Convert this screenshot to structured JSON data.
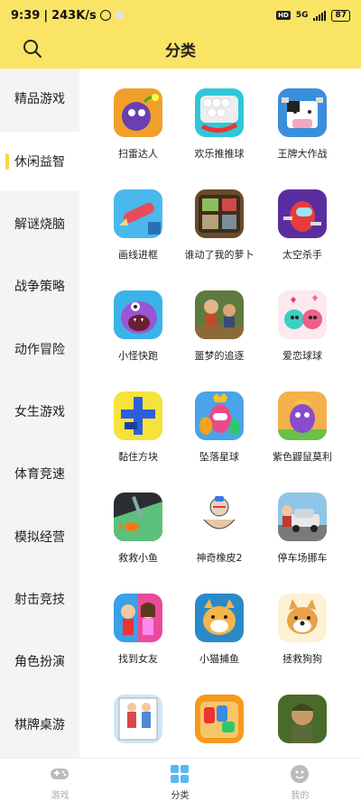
{
  "status": {
    "time": "9:39",
    "net_speed": "243K/s",
    "network": "5G",
    "battery": "87"
  },
  "header": {
    "title": "分类"
  },
  "sidebar": {
    "items": [
      {
        "label": "精品游戏"
      },
      {
        "label": "休闲益智"
      },
      {
        "label": "解谜烧脑"
      },
      {
        "label": "战争策略"
      },
      {
        "label": "动作冒险"
      },
      {
        "label": "女生游戏"
      },
      {
        "label": "体育竞速"
      },
      {
        "label": "模拟经营"
      },
      {
        "label": "射击竞技"
      },
      {
        "label": "角色扮演"
      },
      {
        "label": "棋牌桌游"
      }
    ],
    "active": "休闲益智"
  },
  "games": [
    {
      "name": "扫雷达人",
      "icon": "bomb-icon"
    },
    {
      "name": "欢乐推推球",
      "icon": "balls-icon"
    },
    {
      "name": "王牌大作战",
      "icon": "cow-icon"
    },
    {
      "name": "画线进框",
      "icon": "pencil-icon"
    },
    {
      "name": "谁动了我的萝卜",
      "icon": "puzzle-box-icon"
    },
    {
      "name": "太空杀手",
      "icon": "astronaut-icon"
    },
    {
      "name": "小怪快跑",
      "icon": "monster-icon"
    },
    {
      "name": "噩梦的追逐",
      "icon": "chase-icon"
    },
    {
      "name": "爱恋球球",
      "icon": "love-balls-icon"
    },
    {
      "name": "黏住方块",
      "icon": "blocks-icon"
    },
    {
      "name": "坠落星球",
      "icon": "fall-guys-icon"
    },
    {
      "name": "紫色鼹鼠莫利",
      "icon": "purple-mole-icon"
    },
    {
      "name": "救救小鱼",
      "icon": "fish-icon"
    },
    {
      "name": "神奇橡皮2",
      "icon": "eraser-icon"
    },
    {
      "name": "停车场挪车",
      "icon": "car-icon"
    },
    {
      "name": "找到女友",
      "icon": "couple-icon"
    },
    {
      "name": "小猫捕鱼",
      "icon": "cat-icon"
    },
    {
      "name": "拯救狗狗",
      "icon": "dog-icon"
    },
    {
      "name": "",
      "icon": "dress-icon"
    },
    {
      "name": "",
      "icon": "traffic-icon"
    },
    {
      "name": "",
      "icon": "soldier-icon"
    }
  ],
  "tabs": [
    {
      "label": "游戏",
      "icon": "gamepad-icon"
    },
    {
      "label": "分类",
      "icon": "category-icon"
    },
    {
      "label": "我的",
      "icon": "profile-icon"
    }
  ]
}
